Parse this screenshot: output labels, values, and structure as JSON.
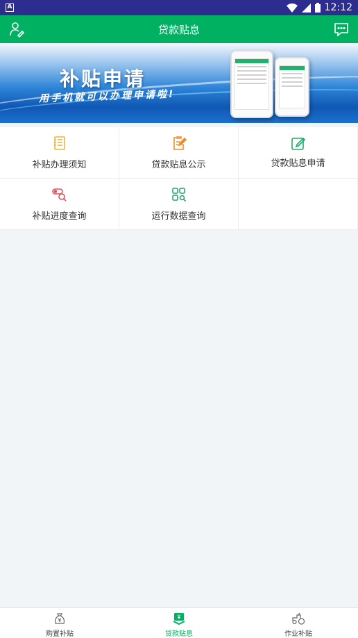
{
  "status_bar": {
    "time": "12:12"
  },
  "app_bar": {
    "title": "贷款贴息"
  },
  "banner": {
    "headline": "补贴申请",
    "slogan": "用手机就可以办理申请啦!"
  },
  "menu": [
    {
      "label": "补贴办理须知",
      "icon": "document-list-icon"
    },
    {
      "label": "贷款贴息公示",
      "icon": "clipboard-edit-icon"
    },
    {
      "label": "贷款贴息申请",
      "icon": "edit-icon"
    },
    {
      "label": "补贴进度查询",
      "icon": "progress-search-icon"
    },
    {
      "label": "运行数据查询",
      "icon": "grid-search-icon"
    }
  ],
  "bottom_nav": [
    {
      "label": "购置补贴",
      "icon": "money-bag-icon",
      "active": false
    },
    {
      "label": "贷款贴息",
      "icon": "yen-box-icon",
      "active": true
    },
    {
      "label": "作业补贴",
      "icon": "tractor-icon",
      "active": false
    }
  ],
  "colors": {
    "primary": "#00b162",
    "status_bar": "#2d2d8f"
  }
}
